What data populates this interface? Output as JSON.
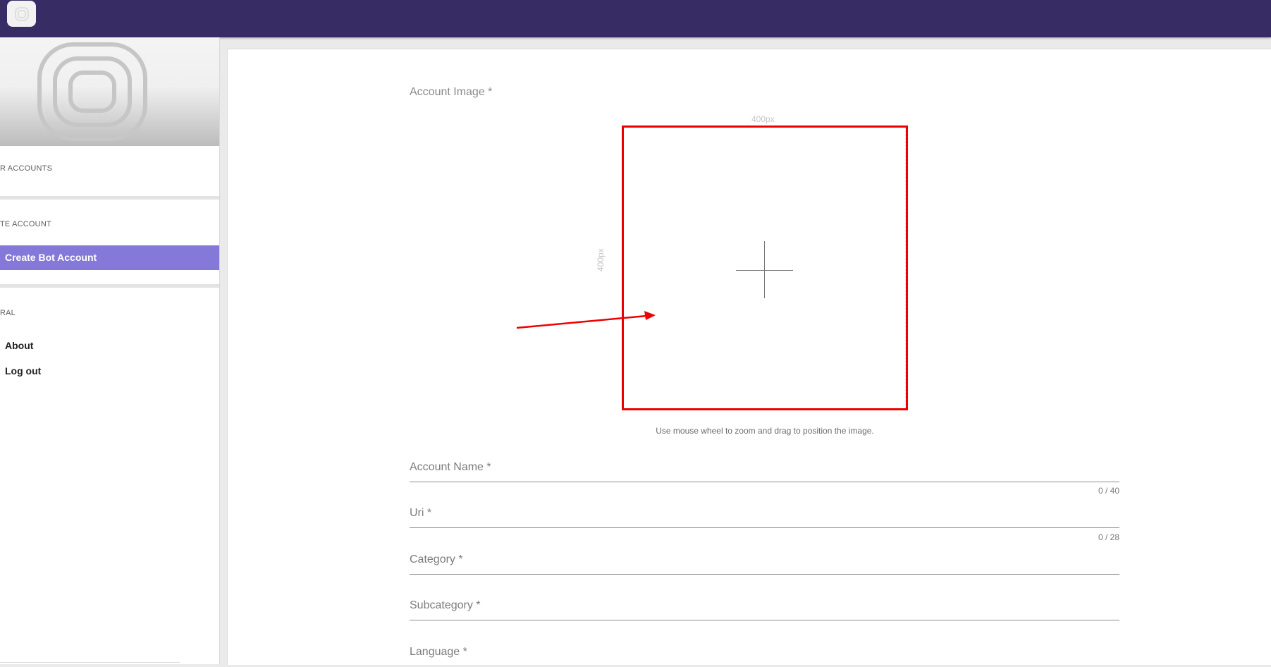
{
  "topbar": {
    "logo_icon": "app-logo-icon"
  },
  "sidebar": {
    "hero_icon": "account-placeholder-icon",
    "sections": [
      {
        "title": "R ACCOUNTS"
      },
      {
        "title": "TE ACCOUNT"
      },
      {
        "title": "RAL"
      }
    ],
    "items": [
      {
        "label": "Create Bot Account",
        "active": true
      },
      {
        "label": "About",
        "active": false
      },
      {
        "label": "Log out",
        "active": false
      }
    ]
  },
  "main": {
    "account_image_label": "Account Image *",
    "width_label": "400px",
    "height_label": "400px",
    "crop_icon": "crosshair-icon",
    "hint": "Use mouse wheel to zoom and drag to position the image.",
    "annotation_color": "#ee0000",
    "fields": [
      {
        "label": "Account Name *",
        "value": "",
        "counter": "0 / 40"
      },
      {
        "label": "Uri *",
        "value": "",
        "counter": "0 / 28"
      },
      {
        "label": "Category *",
        "value": ""
      },
      {
        "label": "Subcategory *",
        "value": ""
      },
      {
        "label": "Language *",
        "value": ""
      }
    ]
  },
  "colors": {
    "topbar": "#372d64",
    "active_item": "#8478d8"
  }
}
